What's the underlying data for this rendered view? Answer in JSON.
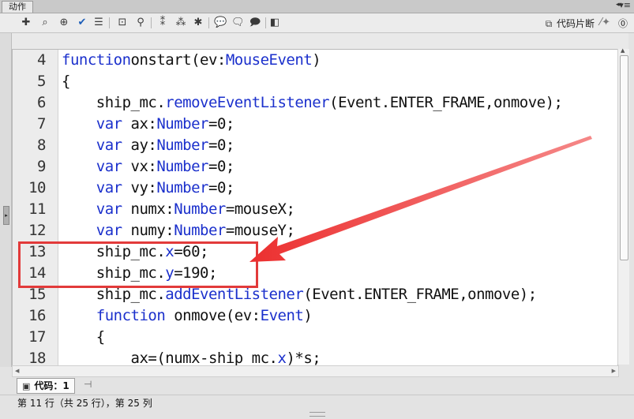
{
  "panel": {
    "tab_label": "动作",
    "collapse_glyph": "◂◂",
    "menu_glyph": "▾≡"
  },
  "toolbar": {
    "icons": [
      "add-action-icon",
      "find-icon",
      "target-icon",
      "check-syntax-icon",
      "auto-format-icon",
      "code-hint-icon",
      "debug-options-icon",
      "collapse-braces-icon",
      "collapse-selection-icon",
      "expand-all-icon",
      "apply-block-comment-icon",
      "apply-line-comment-icon",
      "remove-comment-icon",
      "show-hide-toolbox-icon"
    ],
    "snippets_label": "代码片断",
    "snippets_icon": "code-snippets-icon",
    "wand_icon": "magic-wand-icon",
    "help_icon": "help-icon"
  },
  "code": [
    {
      "n": "4",
      "parts": [
        [
          "kw",
          "function"
        ],
        [
          "",
          "onstart(ev:"
        ],
        [
          "ty",
          "MouseEvent"
        ],
        [
          "",
          ")"
        ]
      ]
    },
    {
      "n": "5",
      "parts": [
        [
          "",
          "{"
        ]
      ]
    },
    {
      "n": "6",
      "parts": [
        [
          "",
          "    ship_mc."
        ],
        [
          "fn",
          "removeEventListener"
        ],
        [
          "",
          "(Event.ENTER_FRAME,onmove);"
        ]
      ]
    },
    {
      "n": "7",
      "parts": [
        [
          "",
          "    "
        ],
        [
          "kw",
          "var"
        ],
        [
          "",
          " ax:"
        ],
        [
          "ty",
          "Number"
        ],
        [
          "",
          "=0;"
        ]
      ]
    },
    {
      "n": "8",
      "parts": [
        [
          "",
          "    "
        ],
        [
          "kw",
          "var"
        ],
        [
          "",
          " ay:"
        ],
        [
          "ty",
          "Number"
        ],
        [
          "",
          "=0;"
        ]
      ]
    },
    {
      "n": "9",
      "parts": [
        [
          "",
          "    "
        ],
        [
          "kw",
          "var"
        ],
        [
          "",
          " vx:"
        ],
        [
          "ty",
          "Number"
        ],
        [
          "",
          "=0;"
        ]
      ]
    },
    {
      "n": "10",
      "parts": [
        [
          "",
          "    "
        ],
        [
          "kw",
          "var"
        ],
        [
          "",
          " vy:"
        ],
        [
          "ty",
          "Number"
        ],
        [
          "",
          "=0;"
        ]
      ]
    },
    {
      "n": "11",
      "parts": [
        [
          "",
          "    "
        ],
        [
          "kw",
          "var"
        ],
        [
          "",
          " numx:"
        ],
        [
          "ty",
          "Number"
        ],
        [
          "",
          "=mouseX;"
        ]
      ]
    },
    {
      "n": "12",
      "parts": [
        [
          "",
          "    "
        ],
        [
          "kw",
          "var"
        ],
        [
          "",
          " numy:"
        ],
        [
          "ty",
          "Number"
        ],
        [
          "",
          "=mouseY;"
        ]
      ]
    },
    {
      "n": "13",
      "parts": [
        [
          "",
          "    ship_mc."
        ],
        [
          "fn",
          "x"
        ],
        [
          "",
          "=60;"
        ]
      ]
    },
    {
      "n": "14",
      "parts": [
        [
          "",
          "    ship_mc."
        ],
        [
          "fn",
          "y"
        ],
        [
          "",
          "=190;"
        ]
      ]
    },
    {
      "n": "15",
      "parts": [
        [
          "",
          "    ship_mc."
        ],
        [
          "fn",
          "addEventListener"
        ],
        [
          "",
          "(Event.ENTER_FRAME,onmove);"
        ]
      ]
    },
    {
      "n": "16",
      "parts": [
        [
          "",
          "    "
        ],
        [
          "kw",
          "function"
        ],
        [
          "",
          " onmove(ev:"
        ],
        [
          "ty",
          "Event"
        ],
        [
          "",
          ")"
        ]
      ]
    },
    {
      "n": "17",
      "parts": [
        [
          "",
          "    {"
        ]
      ]
    },
    {
      "n": "18",
      "parts": [
        [
          "",
          "        ax=(numx-ship_mc."
        ],
        [
          "fn",
          "x"
        ],
        [
          "",
          ")*s;"
        ]
      ]
    }
  ],
  "bottom_tab": {
    "label": "代码：1",
    "icon": "script-file-icon",
    "pin_icon": "pin-icon"
  },
  "status": {
    "text": "第 11 行（共 25 行），第 25 列"
  },
  "annotation": {
    "highlight_color": "#e23a3a",
    "highlighted_lines": [
      "13",
      "14"
    ]
  }
}
